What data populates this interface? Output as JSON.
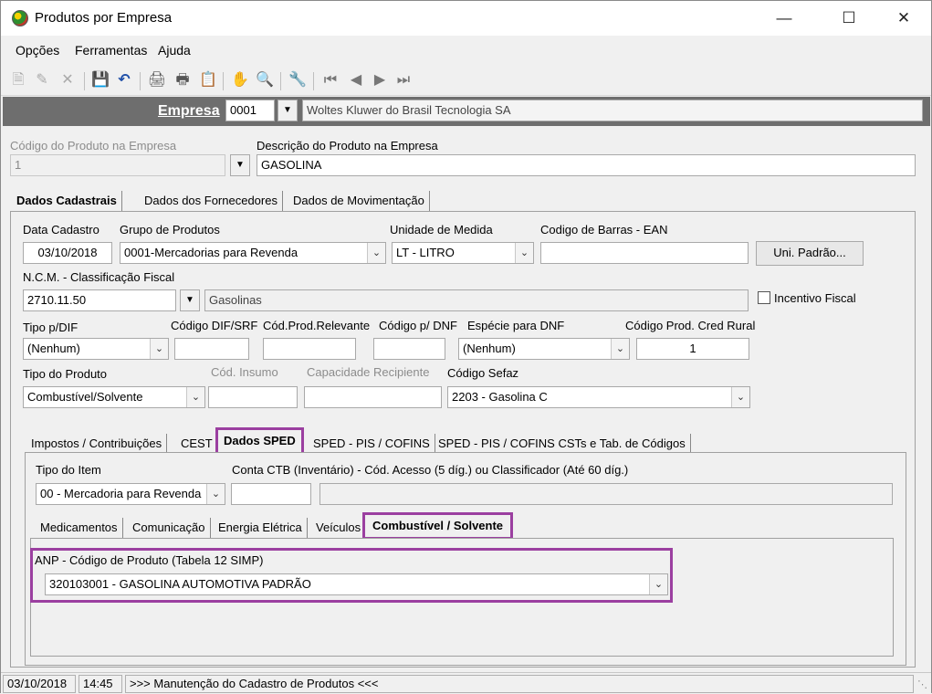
{
  "window": {
    "title": "Produtos por Empresa"
  },
  "menu": {
    "opcoes": "Opções",
    "ferramentas": "Ferramentas",
    "ajuda": "Ajuda"
  },
  "empresa": {
    "label": "Empresa",
    "code": "0001",
    "name": "Woltes Kluwer do Brasil Tecnologia SA"
  },
  "produto": {
    "codigo_label": "Código do Produto na Empresa",
    "codigo_value": "1",
    "descricao_label": "Descrição do Produto na Empresa",
    "descricao_value": "GASOLINA"
  },
  "main_tabs": [
    "Dados Cadastrais",
    "Dados dos Fornecedores",
    "Dados de Movimentação"
  ],
  "dados": {
    "data_cadastro_label": "Data Cadastro",
    "data_cadastro": "03/10/2018",
    "grupo_label": "Grupo de Produtos",
    "grupo": "0001-Mercadorias para Revenda",
    "unidade_label": "Unidade de Medida",
    "unidade": "LT - LITRO",
    "ean_label": "Codigo de Barras - EAN",
    "ean": "",
    "uni_padrao_button": "Uni. Padrão...",
    "ncm_label": "N.C.M. -  Classificação Fiscal",
    "ncm": "2710.11.50",
    "ncm_desc": "Gasolinas",
    "incentivo_label": "Incentivo Fiscal",
    "tipo_dif_label": "Tipo p/DIF",
    "tipo_dif": "(Nenhum)",
    "cod_dif_label": "Código DIF/SRF",
    "cod_dif": "",
    "cod_prod_rel_label": "Cód.Prod.Relevante",
    "cod_prod_rel": "",
    "cod_dnf_label": "Código p/ DNF",
    "cod_dnf": "",
    "especie_dnf_label": "Espécie para DNF",
    "especie_dnf": "(Nenhum)",
    "cod_cred_rural_label": "Código Prod. Cred Rural",
    "cod_cred_rural": "1",
    "tipo_produto_label": "Tipo do Produto",
    "tipo_produto": "Combustível/Solvente",
    "cod_insumo_label": "Cód. Insumo",
    "cod_insumo": "",
    "capacidade_label": "Capacidade Recipiente",
    "capacidade": "",
    "sefaz_label": "Código Sefaz",
    "sefaz": "2203 - Gasolina C"
  },
  "sub_tabs": [
    "Impostos / Contribuições",
    "CEST",
    "Dados SPED",
    "SPED - PIS / COFINS",
    "SPED - PIS / COFINS CSTs e Tab. de Códigos"
  ],
  "sped": {
    "tipo_item_label": "Tipo do Item",
    "tipo_item": "00 - Mercadoria para Revenda",
    "conta_label": "Conta CTB (Inventário) - Cód. Acesso (5 díg.) ou Classificador (Até 60 díg.)",
    "conta_code": "",
    "conta_desc": ""
  },
  "sped_tabs": [
    "Medicamentos",
    "Comunicação",
    "Energia Elétrica",
    "Veículos",
    "Combustível / Solvente"
  ],
  "anp": {
    "label": "ANP - Código de Produto (Tabela 12 SIMP)",
    "value": "320103001 - GASOLINA AUTOMOTIVA PADRÃO"
  },
  "status": {
    "date": "03/10/2018",
    "time": "14:45",
    "message": ">>> Manutenção do Cadastro de Produtos <<<"
  },
  "colors": {
    "highlight": "#9b3fa0",
    "empresa_bar": "#6e6e6e"
  }
}
